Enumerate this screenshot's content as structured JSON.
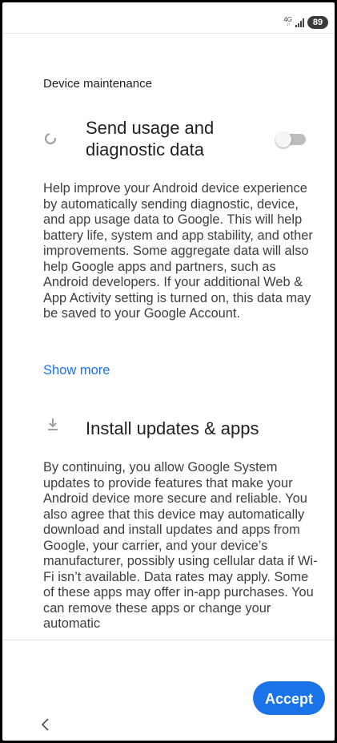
{
  "status_bar": {
    "network": "4G",
    "battery": "89"
  },
  "section_title": "Device maintenance",
  "usage": {
    "title": "Send usage and diagnostic data",
    "toggle_on": false,
    "description": "Help improve your Android device experience by automatically sending diagnostic, device, and app usage data to Google. This will help battery life, system and app stability, and other improvements. Some aggregate data will also help Google apps and partners, such as Android developers. If your additional Web & App Activity setting is turned on, this data may be saved to your Google Account.",
    "show_more": "Show more"
  },
  "install": {
    "title": "Install updates & apps",
    "description": "By continuing, you allow Google System updates to provide features that make your Android device more secure and reliable. You also agree that this device may automatically download and install updates and apps from Google, your carrier, and your device’s manufacturer, possibly using cellular data if Wi-Fi isn’t available. Data rates may apply. Some of these apps may offer in-app purchases. You can remove these apps or change your automatic"
  },
  "accept_label": "Accept",
  "colors": {
    "accent": "#1a73e8",
    "toggle_track": "#bdbdbd",
    "battery_bg": "#3a3a3a"
  }
}
